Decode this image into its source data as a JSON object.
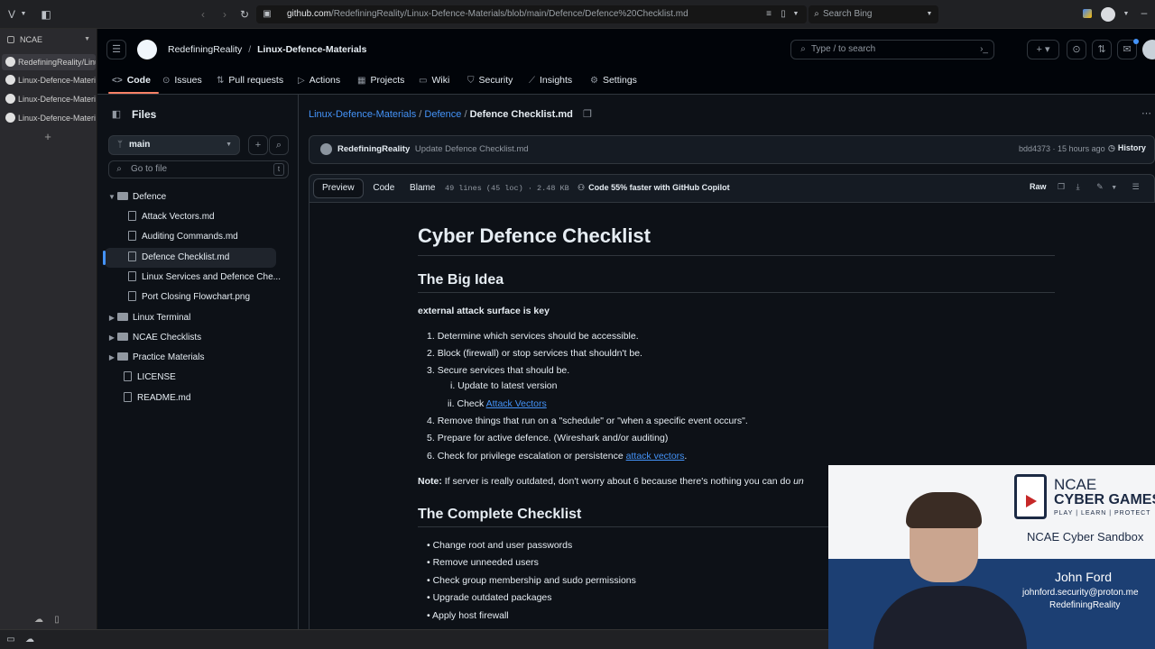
{
  "browser": {
    "url_host": "github.com",
    "url_path": "/RedefiningReality/Linux-Defence-Materials/blob/main/Defence/Defence%20Checklist.md",
    "search_placeholder": "Search Bing",
    "workspace": "NCAE",
    "tabs": [
      {
        "label": "RedefiningReality/Linu"
      },
      {
        "label": "Linux-Defence-Materi"
      },
      {
        "label": "Linux-Defence-Materi"
      },
      {
        "label": "Linux-Defence-Materi"
      }
    ]
  },
  "github": {
    "owner": "RedefiningReality",
    "repo": "Linux-Defence-Materials",
    "search_placeholder": "Type / to search",
    "nav": [
      {
        "label": "Code",
        "icon": "code-icon"
      },
      {
        "label": "Issues",
        "icon": "issue-icon"
      },
      {
        "label": "Pull requests",
        "icon": "pull-request-icon"
      },
      {
        "label": "Actions",
        "icon": "play-icon"
      },
      {
        "label": "Projects",
        "icon": "table-icon"
      },
      {
        "label": "Wiki",
        "icon": "book-icon"
      },
      {
        "label": "Security",
        "icon": "shield-icon"
      },
      {
        "label": "Insights",
        "icon": "graph-icon"
      },
      {
        "label": "Settings",
        "icon": "gear-icon"
      }
    ]
  },
  "files_panel": {
    "title": "Files",
    "branch": "main",
    "goto_placeholder": "Go to file",
    "goto_shortcut": "t",
    "tree": [
      {
        "label": "Defence",
        "type": "folder",
        "expanded": true
      },
      {
        "label": "Attack Vectors.md",
        "type": "file"
      },
      {
        "label": "Auditing Commands.md",
        "type": "file"
      },
      {
        "label": "Defence Checklist.md",
        "type": "file",
        "selected": true
      },
      {
        "label": "Linux Services and Defence Che...",
        "type": "file"
      },
      {
        "label": "Port Closing Flowchart.png",
        "type": "file"
      },
      {
        "label": "Linux Terminal",
        "type": "folder"
      },
      {
        "label": "NCAE Checklists",
        "type": "folder"
      },
      {
        "label": "Practice Materials",
        "type": "folder"
      },
      {
        "label": "LICENSE",
        "type": "file"
      },
      {
        "label": "README.md",
        "type": "file"
      }
    ]
  },
  "file_view": {
    "breadcrumb": {
      "repo": "Linux-Defence-Materials",
      "folder": "Defence",
      "file": "Defence Checklist.md"
    },
    "commit": {
      "author": "RedefiningReality",
      "message": "Update Defence Checklist.md",
      "sha": "bdd4373",
      "time": "15 hours ago",
      "history": "History"
    },
    "tabs": {
      "preview": "Preview",
      "code": "Code",
      "blame": "Blame"
    },
    "stats": "49 lines (45 loc) · 2.48 KB",
    "copilot": "Code 55% faster with GitHub Copilot",
    "raw": "Raw"
  },
  "markdown": {
    "h1": "Cyber Defence Checklist",
    "h2_idea": "The Big Idea",
    "bold_line": "external attack surface is key",
    "steps": [
      "Determine which services should be accessible.",
      "Block (firewall) or stop services that shouldn't be.",
      "Secure services that should be.",
      "Remove things that run on a \"schedule\" or \"when a specific event occurs\".",
      "Prepare for active defence. (Wireshark and/or auditing)",
      "Check for privilege escalation or persistence"
    ],
    "substeps": [
      "Update to latest version",
      "Check"
    ],
    "link_attack_vectors": "Attack Vectors",
    "link_attack_vectors_lc": "attack vectors",
    "note_label": "Note:",
    "note_text": "If server is really outdated, don't worry about 6 because there's nothing you can do",
    "note_tail": "un",
    "h2_complete": "The Complete Checklist",
    "checklist": [
      "Change root and user passwords",
      "Remove unneeded users",
      "Check group membership and sudo permissions",
      "Upgrade outdated packages",
      "Apply host firewall"
    ]
  },
  "webcam": {
    "brand_top": "NCAE",
    "brand_main": "CYBER GAMES",
    "brand_tag": "PLAY | LEARN | PROTECT",
    "sandbox": "NCAE Cyber Sandbox",
    "name": "John Ford",
    "email": "johnford.security@proton.me",
    "handle": "RedefiningReality"
  },
  "colors": {
    "accent": "#f78166",
    "link": "#4493f8",
    "bg": "#0d1117",
    "brand_blue": "#1c3f73"
  }
}
